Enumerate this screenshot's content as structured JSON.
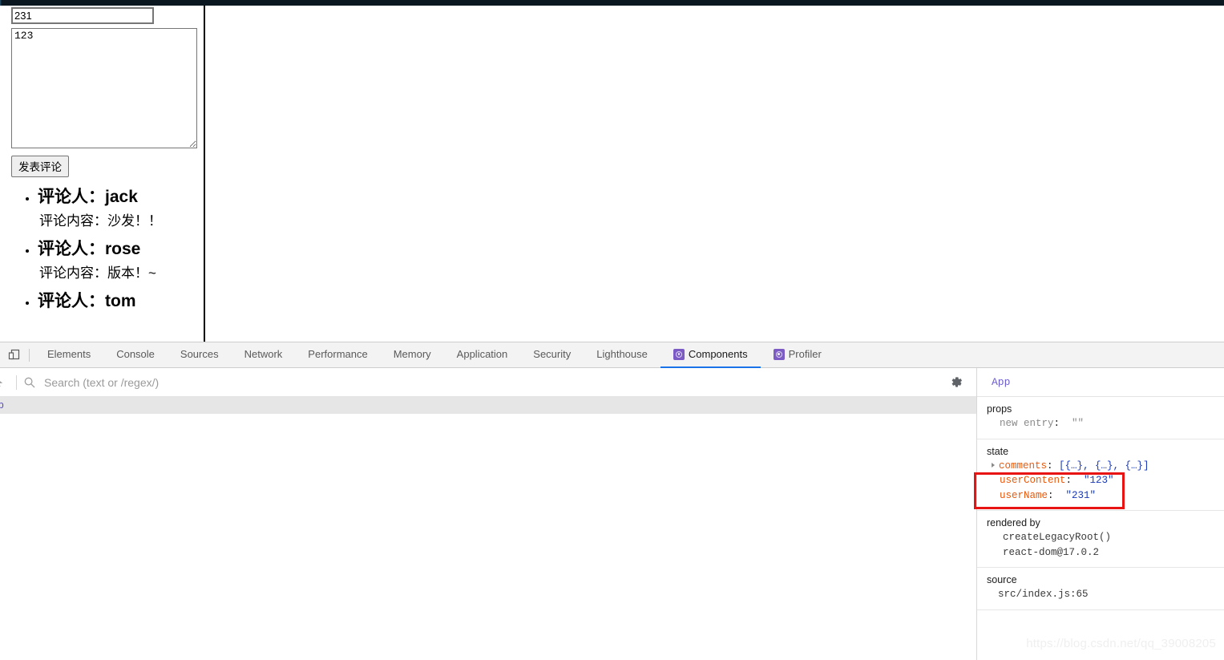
{
  "page": {
    "name_input_value": "231",
    "content_textarea_value": "123",
    "submit_button_label": "发表评论",
    "comments": [
      {
        "author_label": "评论人：",
        "author": "jack",
        "body": "评论内容：沙发！！"
      },
      {
        "author_label": "评论人：",
        "author": "rose",
        "body": "评论内容：版本！~"
      },
      {
        "author_label": "评论人：",
        "author": "tom",
        "body": ""
      }
    ]
  },
  "devtools": {
    "device_toolbar_icon": "device-toolbar-icon",
    "tabs": [
      {
        "label": "Elements",
        "active": false,
        "icon": null
      },
      {
        "label": "Console",
        "active": false,
        "icon": null
      },
      {
        "label": "Sources",
        "active": false,
        "icon": null
      },
      {
        "label": "Network",
        "active": false,
        "icon": null
      },
      {
        "label": "Performance",
        "active": false,
        "icon": null
      },
      {
        "label": "Memory",
        "active": false,
        "icon": null
      },
      {
        "label": "Application",
        "active": false,
        "icon": null
      },
      {
        "label": "Security",
        "active": false,
        "icon": null
      },
      {
        "label": "Lighthouse",
        "active": false,
        "icon": null
      },
      {
        "label": "Components",
        "active": true,
        "icon": "react-icon"
      },
      {
        "label": "Profiler",
        "active": false,
        "icon": "react-icon"
      }
    ],
    "search": {
      "placeholder": "Search (text or /regex/)",
      "value": ""
    },
    "settings_icon": "gear-icon",
    "tree": {
      "selected_row_label": "pp"
    },
    "inspector": {
      "component_name": "App",
      "props": {
        "title": "props",
        "entries": [
          {
            "key": "new entry",
            "value": "\"\"",
            "muted": true
          }
        ]
      },
      "state": {
        "title": "state",
        "entries": [
          {
            "key": "comments",
            "value": "[{…}, {…}, {…}]",
            "expandable": true
          },
          {
            "key": "userContent",
            "value": "\"123\"",
            "highlighted": true
          },
          {
            "key": "userName",
            "value": "\"231\"",
            "highlighted": true
          }
        ]
      },
      "rendered_by": {
        "title": "rendered by",
        "lines": [
          "createLegacyRoot()",
          "react-dom@17.0.2"
        ]
      },
      "source": {
        "title": "source",
        "lines": [
          "src/index.js:65"
        ]
      }
    },
    "accent_color": "#1a73e8",
    "highlight_box_color": "#e81414"
  },
  "watermark": "https://blog.csdn.net/qq_39008205"
}
